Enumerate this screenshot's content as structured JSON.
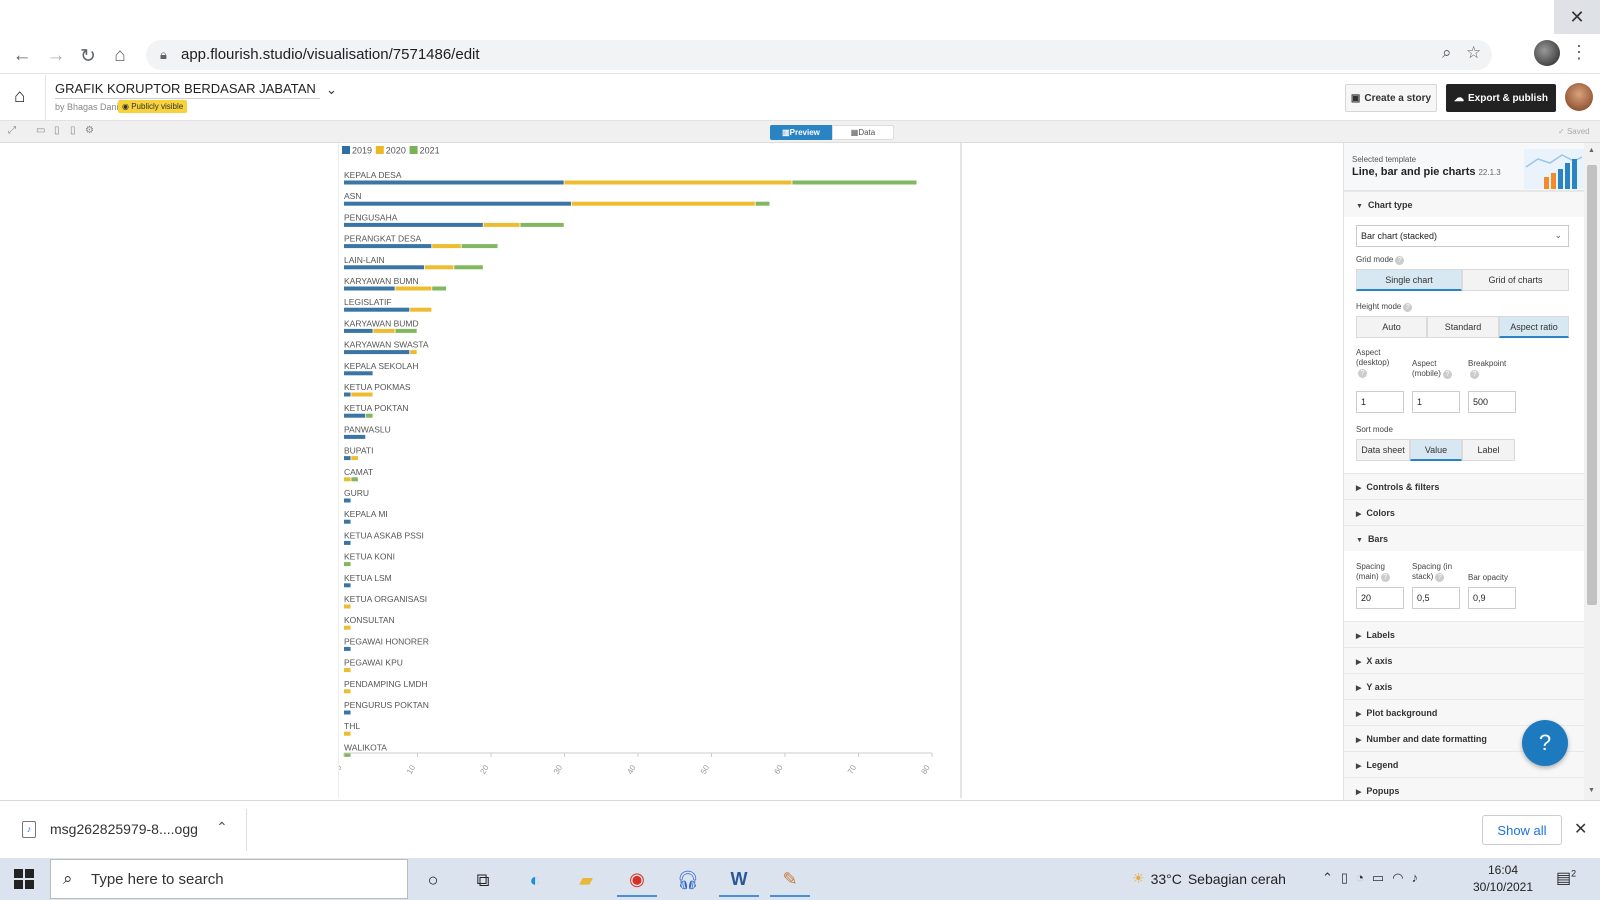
{
  "browser": {
    "url": "app.flourish.studio/visualisation/7571486/edit",
    "icons": [
      "back-icon",
      "forward-icon",
      "reload-icon",
      "home-icon",
      "lock-icon",
      "zoom-icon",
      "star-icon",
      "close-icon",
      "kebab-icon"
    ]
  },
  "header": {
    "title": "GRAFIK KORUPTOR BERDASAR JABATAN DI JA",
    "byline": "by Bhagas Dani",
    "badge": "Publicly visible",
    "create_story": "Create a story",
    "export_publish": "Export & publish"
  },
  "toolbar": {
    "preview": "Preview",
    "data": "Data",
    "saved": "Saved"
  },
  "chart_data": {
    "type": "bar",
    "orientation": "horizontal",
    "stacked": true,
    "legend_position": "top-left",
    "grid": false,
    "categories": [
      "KEPALA DESA",
      "ASN",
      "PENGUSAHA",
      "PERANGKAT DESA",
      "LAIN-LAIN",
      "KARYAWAN BUMN",
      "LEGISLATIF",
      "KARYAWAN BUMD",
      "KARYAWAN SWASTA",
      "KEPALA SEKOLAH",
      "KETUA POKMAS",
      "KETUA POKTAN",
      "PANWASLU",
      "BUPATI",
      "CAMAT",
      "GURU",
      "KEPALA MI",
      "KETUA ASKAB PSSI",
      "KETUA KONI",
      "KETUA LSM",
      "KETUA ORGANISASI",
      "KONSULTAN",
      "PEGAWAI HONORER",
      "PEGAWAI KPU",
      "PENDAMPING LMDH",
      "PENGURUS POKTAN",
      "THL",
      "WALIKOTA"
    ],
    "series": [
      {
        "name": "2019",
        "color": "#2f6e9e",
        "values": [
          30,
          31,
          19,
          12,
          11,
          7,
          9,
          4,
          9,
          4,
          1,
          3,
          3,
          1,
          0,
          1,
          1,
          1,
          0,
          1,
          0,
          0,
          1,
          0,
          0,
          1,
          0,
          0
        ]
      },
      {
        "name": "2020",
        "color": "#ecb824",
        "values": [
          31,
          25,
          5,
          4,
          4,
          5,
          3,
          3,
          1,
          0,
          3,
          0,
          0,
          1,
          1,
          0,
          0,
          0,
          0,
          0,
          1,
          1,
          0,
          1,
          1,
          0,
          1,
          0
        ]
      },
      {
        "name": "2021",
        "color": "#7ab356",
        "values": [
          17,
          2,
          6,
          5,
          4,
          2,
          0,
          3,
          0,
          0,
          0,
          1,
          0,
          0,
          1,
          0,
          0,
          0,
          1,
          0,
          0,
          0,
          0,
          0,
          0,
          0,
          0,
          1
        ]
      }
    ],
    "x_ticks": [
      "0",
      "10",
      "20",
      "30",
      "40",
      "50",
      "60",
      "70",
      "80"
    ],
    "xlim": [
      0,
      80
    ]
  },
  "panel": {
    "selected_template_label": "Selected template",
    "template_name": "Line, bar and pie charts",
    "template_version": "22.1.3",
    "chart_type_section": "Chart type",
    "chart_type_value": "Bar chart (stacked)",
    "grid_mode_label": "Grid mode",
    "grid_mode_options": [
      "Single chart",
      "Grid of charts"
    ],
    "height_mode_label": "Height mode",
    "height_mode_options": [
      "Auto",
      "Standard",
      "Aspect ratio"
    ],
    "aspect_desktop_label": "Aspect (desktop)",
    "aspect_mobile_label": "Aspect (mobile)",
    "breakpoint_label": "Breakpoint",
    "aspect_desktop_value": "1",
    "aspect_mobile_value": "1",
    "breakpoint_value": "500",
    "sort_mode_label": "Sort mode",
    "sort_mode_options": [
      "Data sheet",
      "Value",
      "Label"
    ],
    "sections_collapsed_1": [
      "Controls & filters",
      "Colors"
    ],
    "bars_section": "Bars",
    "spacing_main_label": "Spacing (main)",
    "spacing_stack_label": "Spacing (in stack)",
    "bar_opacity_label": "Bar opacity",
    "spacing_main_value": "20",
    "spacing_stack_value": "0,5",
    "bar_opacity_value": "0,9",
    "sections_collapsed_2": [
      "Labels",
      "X axis",
      "Y axis",
      "Plot background",
      "Number and date formatting",
      "Legend",
      "Popups"
    ]
  },
  "help_button": "?",
  "downloads": {
    "file": "msg262825979-8....ogg",
    "show_all": "Show all"
  },
  "taskbar": {
    "search_placeholder": "Type here to search",
    "temperature": "33°C",
    "weather_desc": "Sebagian cerah",
    "time": "16:04",
    "date": "30/10/2021",
    "notif_count": "2"
  }
}
